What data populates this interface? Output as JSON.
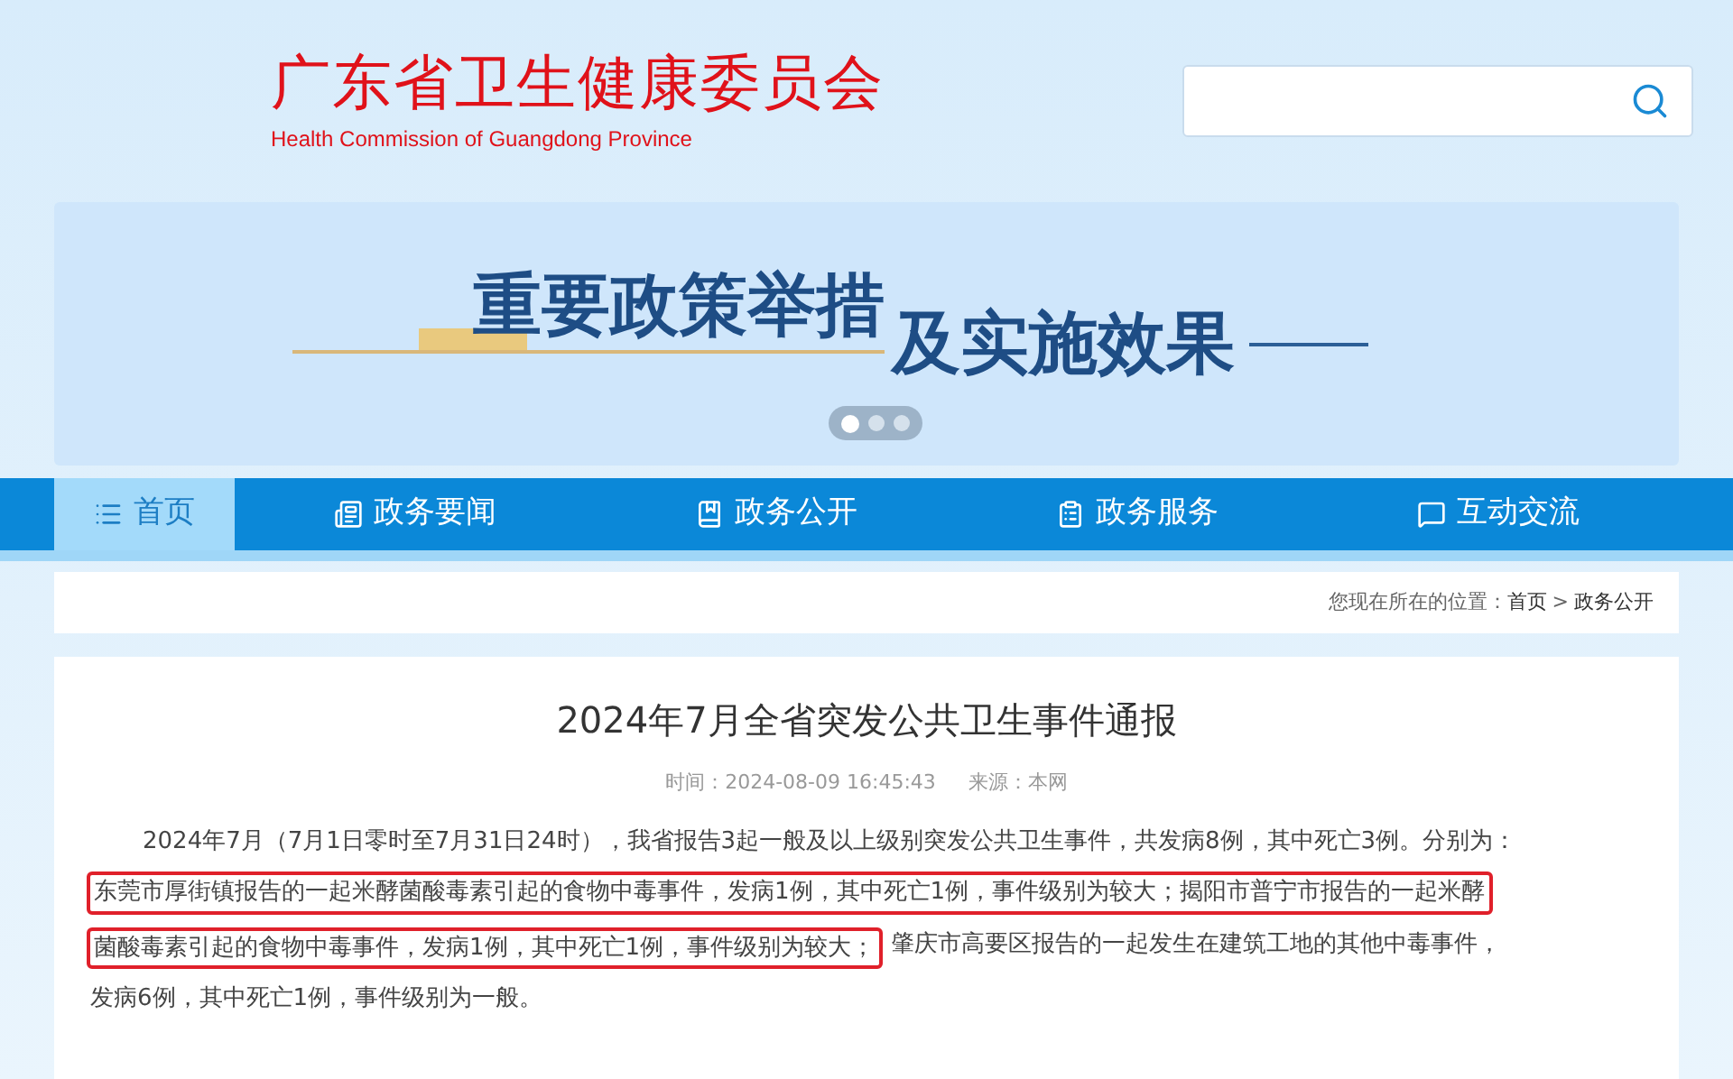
{
  "header": {
    "title": "广东省卫生健康委员会",
    "subtitle": "Health Commission of Guangdong Province"
  },
  "banner": {
    "headline": "重要政策举措",
    "tagline": "及实施效果",
    "dots": [
      {
        "selected": true
      },
      {
        "selected": false
      },
      {
        "selected": false
      }
    ]
  },
  "nav": [
    {
      "label": "首页",
      "selected": true
    },
    {
      "label": "政务要闻",
      "selected": false
    },
    {
      "label": "政务公开",
      "selected": false
    },
    {
      "label": "政务服务",
      "selected": false
    },
    {
      "label": "互动交流",
      "selected": false
    }
  ],
  "breadcrumb": {
    "prefix": "您现在所在的位置：",
    "items": [
      "首页",
      "政务公开"
    ],
    "separator": ">"
  },
  "article": {
    "title": "2024年7月全省突发公共卫生事件通报",
    "time": "时间：2024-08-09 16:45:43",
    "source": "来源：本网",
    "lines": [
      {
        "indent": true,
        "segments": [
          {
            "text": "2024年7月（7月1日零时至7月31日24时），我省报告3起一般及以上级别突发公共卫生事件，共发病8例，其中死亡3例。分别为：",
            "highlighted": false
          }
        ]
      },
      {
        "indent": false,
        "segments": [
          {
            "text": "东莞市厚街镇报告的一起米酵菌酸毒素引起的食物中毒事件，发病1例，其中死亡1例，事件级别为较大；揭阳市普宁市报告的一起米酵",
            "highlighted": true
          }
        ]
      },
      {
        "indent": false,
        "segments": [
          {
            "text": "菌酸毒素引起的食物中毒事件，发病1例，其中死亡1例，事件级别为较大；",
            "highlighted": true
          },
          {
            "text": "肇庆市高要区报告的一起发生在建筑工地的其他中毒事件，",
            "highlighted": false
          }
        ]
      },
      {
        "indent": false,
        "segments": [
          {
            "text": "发病6例，其中死亡1例，事件级别为一般。",
            "highlighted": false
          }
        ]
      }
    ]
  }
}
